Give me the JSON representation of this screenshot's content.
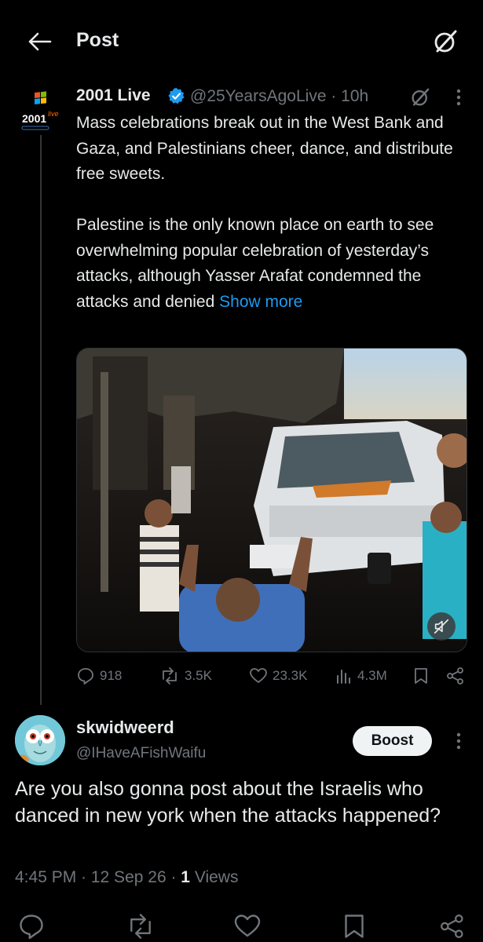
{
  "header": {
    "title": "Post"
  },
  "post": {
    "author_name": "2001 Live",
    "avatar_label": "2001",
    "avatar_sup": "live",
    "handle_time": "@25YearsAgoLive · 10h",
    "paragraph1": "Mass celebrations break out in the West Bank and Gaza, and Palestinians cheer, dance, and distribute free sweets.",
    "paragraph2": "Palestine is the only known place on earth to see overwhelming popular celebration of yesterday’s attacks, although Yasser Arafat condemned the attacks and denied ",
    "show_more": "Show more",
    "stats": {
      "replies": "918",
      "reposts": "3.5K",
      "likes": "23.3K",
      "views": "4.3M"
    },
    "colors": {
      "accent": "#1d9bf0",
      "verified": "#1d9bf0",
      "muted": "#71767b"
    }
  },
  "reply": {
    "author_name": "skwidweerd",
    "handle": "@IHaveAFishWaifu",
    "boost_label": "Boost",
    "text": "Are you also gonna post about the Israelis who danced in new york when the attacks happened?",
    "meta_time": "4:45 PM · 12 Sep 26 · ",
    "meta_views_count": "1",
    "meta_views_label": " Views"
  }
}
